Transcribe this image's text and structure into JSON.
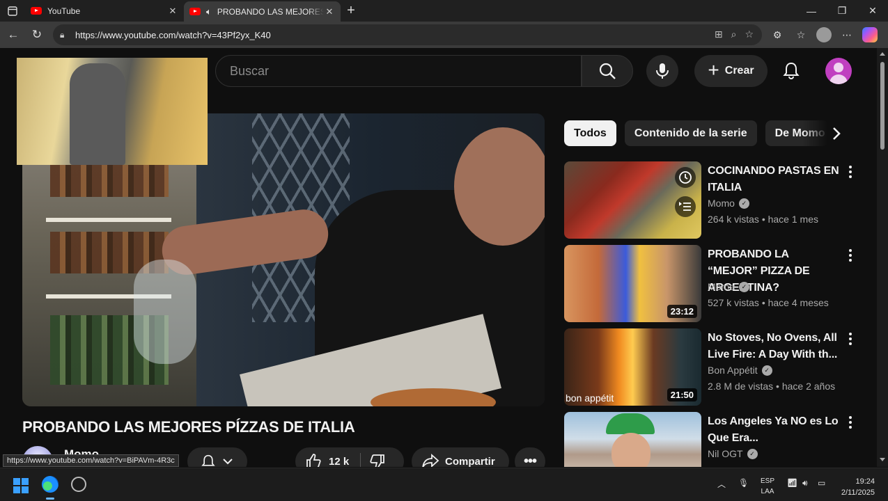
{
  "browser": {
    "tabs": [
      {
        "title": "YouTube"
      },
      {
        "title": "PROBANDO LAS MEJORES P"
      }
    ],
    "url": "https://www.youtube.com/watch?v=43Pf2yx_K40",
    "status_url": "https://www.youtube.com/watch?v=BiPAVm-4R3c"
  },
  "youtube": {
    "search_placeholder": "Buscar",
    "create_label": "Crear",
    "video_title": "PROBANDO LAS MEJORES PÍZZAS DE ITALIA",
    "channel_name": "Momo",
    "likes": "12 k",
    "share_label": "Compartir",
    "chips": [
      "Todos",
      "Contenido de la serie",
      "De Momo"
    ],
    "recommendations": [
      {
        "title": "COCINANDO PASTAS EN ITALIA",
        "channel": "Momo",
        "meta": "264 k vistas • hace 1 mes",
        "duration": ""
      },
      {
        "title": "PROBANDO LA “MEJOR” PIZZA DE ARGENTINA?",
        "channel": "Momo",
        "meta": "527 k vistas • hace 4 meses",
        "duration": "23:12"
      },
      {
        "title": "No Stoves, No Ovens, All Live Fire: A Day With th...",
        "channel": "Bon Appétit",
        "meta": "2.8 M de vistas • hace 2 años",
        "duration": "21:50",
        "thumb_text": "bon appétit"
      },
      {
        "title": "Los Angeles Ya NO es Lo Que Era...",
        "channel": "Nil OGT",
        "meta": "",
        "duration": ""
      }
    ]
  },
  "taskbar": {
    "lang_1": "ESP",
    "lang_2": "LAA",
    "time": "19:24",
    "date": "2/11/2025"
  },
  "colors": {
    "yt_background": "#0f0f0f",
    "chip_active": "#f1f1f1",
    "avatar": "#c03fc0",
    "youtube_red": "#ff0000"
  }
}
